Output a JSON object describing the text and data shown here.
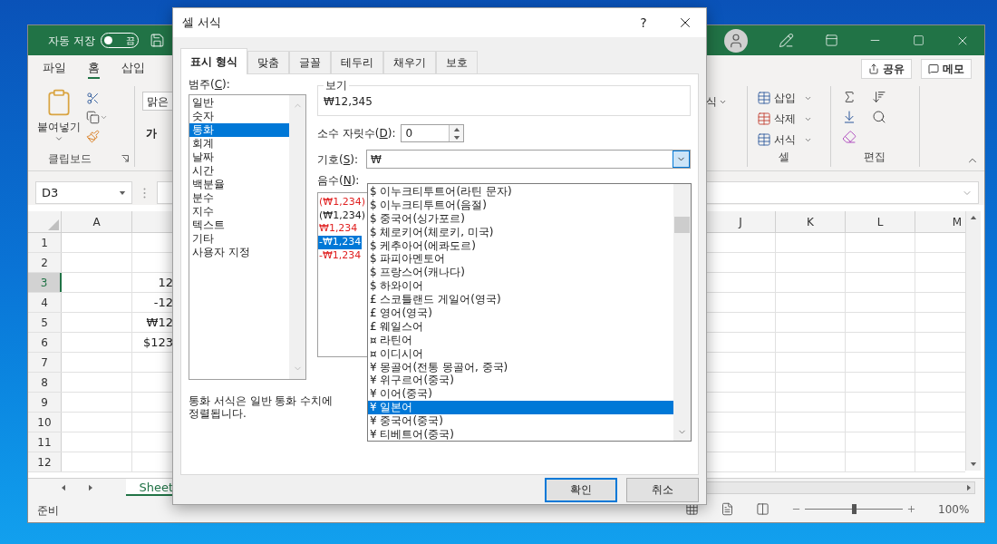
{
  "excel": {
    "autosave": {
      "label": "자동 저장",
      "toggle": {
        "label": "끔",
        "on": false
      }
    },
    "ribbon_tabs": [
      {
        "label": "파일",
        "selected": false
      },
      {
        "label": "홈",
        "selected": true
      },
      {
        "label": "삽입",
        "selected": false
      }
    ],
    "share_button": "공유",
    "memo_button": "메모",
    "clipboard_group": {
      "paste_label": "붙여넣기",
      "group_label": "클립보드"
    },
    "font_group": {
      "font_name": "맑은",
      "bold_button": "가"
    },
    "styles_fragment": "식",
    "cells_group": {
      "items": [
        "삽입",
        "삭제",
        "서식"
      ],
      "group_label": "셀"
    },
    "editing_group": {
      "group_label": "편집"
    },
    "name_box": "D3",
    "left_columns": [
      "A"
    ],
    "right_columns": [
      "J",
      "K",
      "L",
      "M"
    ],
    "rows": [
      {
        "header": "1",
        "selected": false
      },
      {
        "header": "2",
        "selected": false
      },
      {
        "header": "3",
        "selected": true,
        "value": "12"
      },
      {
        "header": "4",
        "selected": false,
        "value": "-12"
      },
      {
        "header": "5",
        "selected": false,
        "value": "₩12"
      },
      {
        "header": "6",
        "selected": false,
        "value": "$123"
      },
      {
        "header": "7",
        "selected": false
      },
      {
        "header": "8",
        "selected": false
      },
      {
        "header": "9",
        "selected": false
      },
      {
        "header": "10",
        "selected": false
      },
      {
        "header": "11",
        "selected": false
      },
      {
        "header": "12",
        "selected": false
      }
    ],
    "sheet_tab": "Sheet",
    "status": "준비",
    "zoom_slider": {
      "level": 0.5
    },
    "zoom": "100%"
  },
  "dialog": {
    "title": "셀 서식",
    "help_button": "?",
    "tabs": [
      {
        "label": "표시 형식",
        "selected": true
      },
      {
        "label": "맞춤",
        "selected": false
      },
      {
        "label": "글꼴",
        "selected": false
      },
      {
        "label": "테두리",
        "selected": false
      },
      {
        "label": "채우기",
        "selected": false
      },
      {
        "label": "보호",
        "selected": false
      }
    ],
    "category_label": {
      "before": "범주(",
      "key": "C",
      "after": "):"
    },
    "categories": [
      {
        "label": "일반",
        "selected": false
      },
      {
        "label": "숫자",
        "selected": false
      },
      {
        "label": "통화",
        "selected": true
      },
      {
        "label": "회계",
        "selected": false
      },
      {
        "label": "날짜",
        "selected": false
      },
      {
        "label": "시간",
        "selected": false
      },
      {
        "label": "백분율",
        "selected": false
      },
      {
        "label": "분수",
        "selected": false
      },
      {
        "label": "지수",
        "selected": false
      },
      {
        "label": "텍스트",
        "selected": false
      },
      {
        "label": "기타",
        "selected": false
      },
      {
        "label": "사용자 지정",
        "selected": false
      }
    ],
    "preview": {
      "legend": "보기",
      "value": "₩12,345"
    },
    "decimal_places": {
      "label": {
        "before": "소수 자릿수(",
        "key": "D",
        "after": "):"
      },
      "value": "0"
    },
    "symbol": {
      "label": {
        "before": "기호(",
        "key": "S",
        "after": "):"
      },
      "value": "₩",
      "expanded": true,
      "options": [
        {
          "label": "$ 이누크티투트어(라틴 문자)",
          "selected": false
        },
        {
          "label": "$ 이누크티투트어(음절)",
          "selected": false
        },
        {
          "label": "$ 중국어(싱가포르)",
          "selected": false
        },
        {
          "label": "$ 체로키어(체로키, 미국)",
          "selected": false
        },
        {
          "label": "$ 케추아어(에콰도르)",
          "selected": false
        },
        {
          "label": "$ 파피아멘토어",
          "selected": false
        },
        {
          "label": "$ 프랑스어(캐나다)",
          "selected": false
        },
        {
          "label": "$ 하와이어",
          "selected": false
        },
        {
          "label": "£ 스코틀랜드 게일어(영국)",
          "selected": false
        },
        {
          "label": "£ 영어(영국)",
          "selected": false
        },
        {
          "label": "£ 웨일스어",
          "selected": false
        },
        {
          "label": "¤ 라틴어",
          "selected": false
        },
        {
          "label": "¤ 이디시어",
          "selected": false
        },
        {
          "label": "¥ 몽골어(전통 몽골어, 중국)",
          "selected": false
        },
        {
          "label": "¥ 위구르어(중국)",
          "selected": false
        },
        {
          "label": "¥ 이어(중국)",
          "selected": false
        },
        {
          "label": "¥ 일본어",
          "selected": true
        },
        {
          "label": "¥ 중국어(중국)",
          "selected": false
        },
        {
          "label": "¥ 티베트어(중국)",
          "selected": false
        }
      ]
    },
    "negative_numbers": {
      "label": {
        "before": "음수(",
        "key": "N",
        "after": "):"
      },
      "options": [
        {
          "label": "(₩1,234)",
          "red": true,
          "selected": false
        },
        {
          "label": "(₩1,234)",
          "red": false,
          "selected": false
        },
        {
          "label": "₩1,234",
          "red": true,
          "selected": false
        },
        {
          "label": "-₩1,234",
          "red": false,
          "selected": true
        },
        {
          "label": "-₩1,234",
          "red": true,
          "selected": false
        }
      ]
    },
    "description_lines": [
      "통화 서식은 일반 통화 수치에",
      "정렬됩니다."
    ],
    "buttons": [
      {
        "label": "확인",
        "kind": "default"
      },
      {
        "label": "취소",
        "kind": "normal"
      }
    ]
  }
}
